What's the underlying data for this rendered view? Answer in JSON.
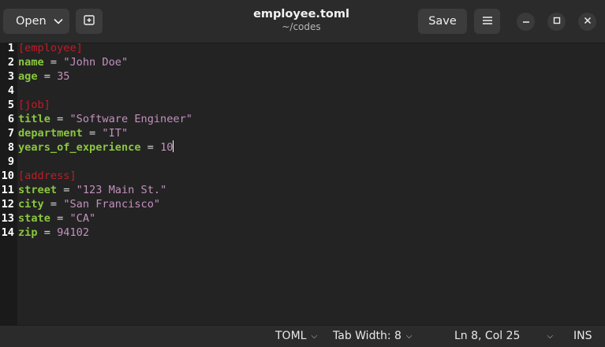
{
  "header": {
    "open_label": "Open",
    "title": "employee.toml",
    "subtitle": "~/codes",
    "save_label": "Save"
  },
  "icons": {
    "open_menu": "chevron-down-icon",
    "new_tab": "new-tab-icon",
    "menu": "hamburger-icon",
    "minimize": "minimize-icon",
    "maximize": "maximize-icon",
    "close": "close-icon"
  },
  "colors": {
    "section": "#c01c28",
    "key": "#8ac73f",
    "string": "#c291be",
    "background": "#232323"
  },
  "editor": {
    "lines": [
      {
        "num": "1",
        "section": "[employee]"
      },
      {
        "num": "2",
        "key": "name",
        "op": " = ",
        "value": "\"John Doe\"",
        "vtype": "str"
      },
      {
        "num": "3",
        "key": "age",
        "op": " = ",
        "value": "35",
        "vtype": "num"
      },
      {
        "num": "4"
      },
      {
        "num": "5",
        "section": "[job]"
      },
      {
        "num": "6",
        "key": "title",
        "op": " = ",
        "value": "\"Software Engineer\"",
        "vtype": "str"
      },
      {
        "num": "7",
        "key": "department",
        "op": " = ",
        "value": "\"IT\"",
        "vtype": "str"
      },
      {
        "num": "8",
        "key": "years_of_experience",
        "op": " = ",
        "value": "10",
        "vtype": "num",
        "cursor": true
      },
      {
        "num": "9"
      },
      {
        "num": "10",
        "section": "[address]"
      },
      {
        "num": "11",
        "key": "street",
        "op": " = ",
        "value": "\"123 Main St.\"",
        "vtype": "str"
      },
      {
        "num": "12",
        "key": "city",
        "op": " = ",
        "value": "\"San Francisco\"",
        "vtype": "str"
      },
      {
        "num": "13",
        "key": "state",
        "op": " = ",
        "value": "\"CA\"",
        "vtype": "str"
      },
      {
        "num": "14",
        "key": "zip",
        "op": " = ",
        "value": "94102",
        "vtype": "num"
      }
    ]
  },
  "statusbar": {
    "language": "TOML",
    "tab_width": "Tab Width: 8",
    "position": "Ln 8, Col 25",
    "mode": "INS"
  }
}
